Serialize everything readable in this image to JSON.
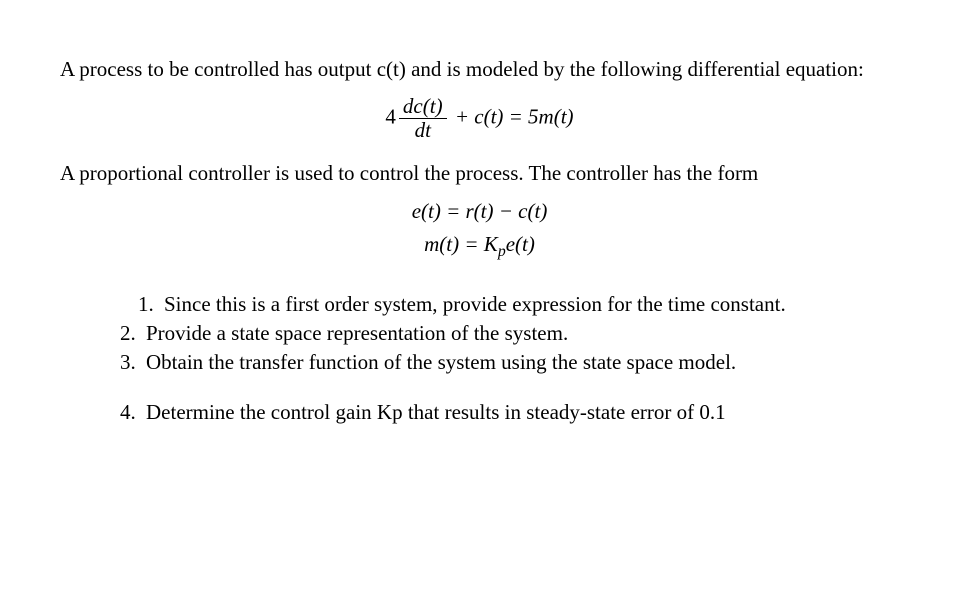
{
  "intro1": "A process to be controlled has output c(t) and is modeled by the following differential equation:",
  "eq1": {
    "coef": "4",
    "frac_num": "dc(t)",
    "frac_den": "dt",
    "rest": "+ c(t) = 5m(t)"
  },
  "intro2": "A proportional controller is used to control the process. The controller has the form",
  "eq2_line1": "e(t) = r(t) − c(t)",
  "eq2_line2_pre": "m(t) = K",
  "eq2_line2_sub": "p",
  "eq2_line2_post": "e(t)",
  "questions": [
    {
      "num": "1.",
      "text": "Since this is a first order system, provide expression for the time constant.",
      "indent": true
    },
    {
      "num": "2.",
      "text": "Provide a state space representation of the system.",
      "indent": false
    },
    {
      "num": "3.",
      "text": "Obtain the transfer function of the system using the state space model.",
      "indent": false
    }
  ],
  "question4": {
    "num": "4.",
    "text": "Determine the control gain Kp that results in steady-state error of 0.1",
    "indent": false
  }
}
